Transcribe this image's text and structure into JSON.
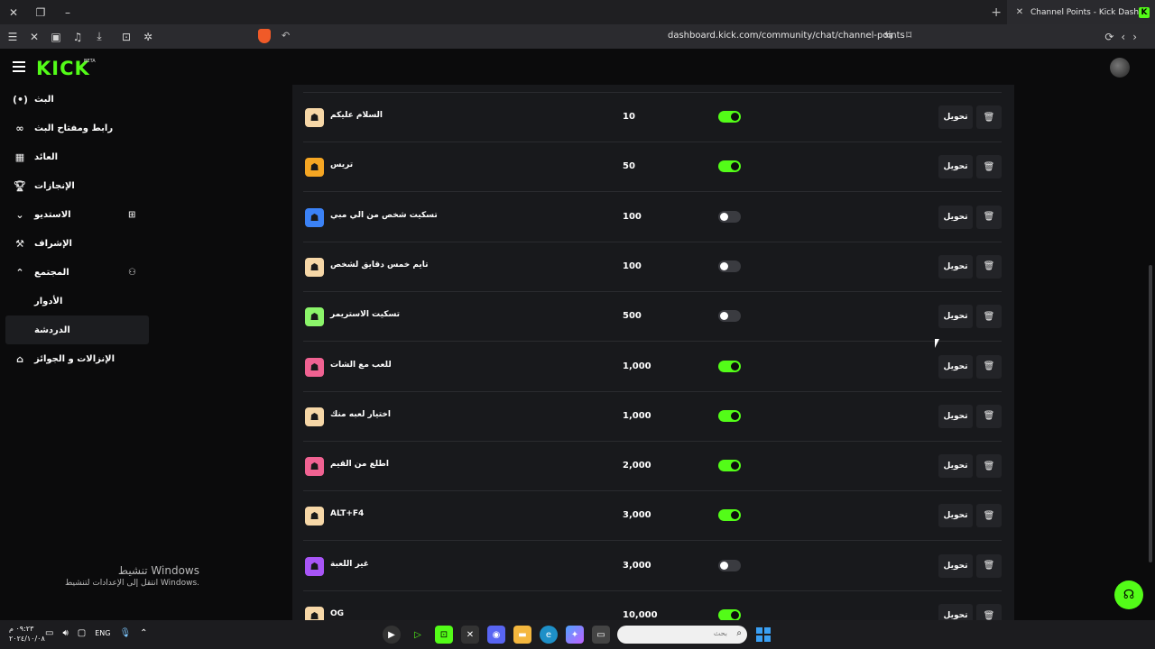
{
  "browser": {
    "tab_title": "Channel Points - Kick Dashboard",
    "favicon_letter": "K",
    "url": "dashboard.kick.com/community/chat/channel-points"
  },
  "header": {
    "logo": "KICK",
    "beta": "BETA"
  },
  "sidebar": {
    "items": [
      {
        "label": "البث",
        "icon": "broadcast-icon"
      },
      {
        "label": "رابط ومفتاح البث",
        "icon": "link-icon"
      },
      {
        "label": "العائد",
        "icon": "chart-icon"
      },
      {
        "label": "الإنجازات",
        "icon": "trophy-icon"
      },
      {
        "label": "الاستديو",
        "icon": "chevron-down-icon"
      },
      {
        "label": "الإشراف",
        "icon": "hammer-icon"
      },
      {
        "label": "المجتمع",
        "icon": "chevron-up-icon"
      },
      {
        "label": "الإنزالات و الجوائز",
        "icon": "gift-icon"
      }
    ],
    "sub_items": [
      {
        "label": "الأدوار"
      },
      {
        "label": "الدردشة"
      }
    ]
  },
  "rewards": {
    "edit_label": "تحويل",
    "rows": [
      {
        "name": "السلام عليكم",
        "cost": "10",
        "enabled": true,
        "color": "#f6d7a7"
      },
      {
        "name": "تريس",
        "cost": "50",
        "enabled": true,
        "color": "#f5a623"
      },
      {
        "name": "تسكيت شخص من الي مبي",
        "cost": "100",
        "enabled": false,
        "color": "#3b82f6"
      },
      {
        "name": "تايم خمس دقايق لشخص",
        "cost": "100",
        "enabled": false,
        "color": "#f6d7a7"
      },
      {
        "name": "تسكيت الاستريمر",
        "cost": "500",
        "enabled": false,
        "color": "#8bf56a"
      },
      {
        "name": "للعب مع الشات",
        "cost": "1,000",
        "enabled": true,
        "color": "#f06292"
      },
      {
        "name": "اختيار لعبه منك",
        "cost": "1,000",
        "enabled": true,
        "color": "#f6d7a7"
      },
      {
        "name": "اطلع من القيم",
        "cost": "2,000",
        "enabled": true,
        "color": "#f06292"
      },
      {
        "name": "ALT+F4",
        "cost": "3,000",
        "enabled": true,
        "color": "#f6d7a7"
      },
      {
        "name": "غير اللعبة",
        "cost": "3,000",
        "enabled": false,
        "color": "#a855f7"
      },
      {
        "name": "OG",
        "cost": "10,000",
        "enabled": true,
        "color": "#f6d7a7"
      }
    ]
  },
  "watermark": {
    "title": "تنشيط Windows",
    "subtitle": "انتقل إلى الإعدادات لتنشيط Windows."
  },
  "taskbar": {
    "time": "٠٩:٢٣ م",
    "date": "٢٠٢٤/١٠/٠٨",
    "lang": "ENG",
    "search_placeholder": "بحث"
  }
}
